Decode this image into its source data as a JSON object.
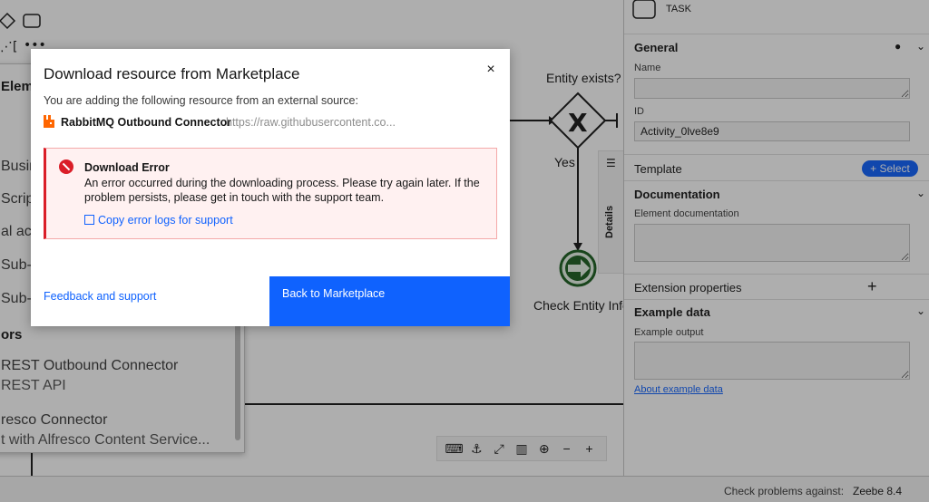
{
  "canvas": {
    "gateway_label": "Entity exists?",
    "yes_label": "Yes",
    "task_label": "Check Entity Info"
  },
  "element_popup": {
    "heading": "Elem",
    "items": [
      "Business",
      "Script task",
      "al activity",
      "Sub-process",
      "Sub-process"
    ],
    "group": "ors",
    "connectors": [
      {
        "name": "REST Outbound Connector",
        "desc": "REST API"
      },
      {
        "name": "resco Connector",
        "desc": "t with Alfresco Content Service..."
      }
    ]
  },
  "details_tab": {
    "label": "Details"
  },
  "properties": {
    "element_type": "TASK",
    "general": {
      "header": "General",
      "name_label": "Name",
      "name_value": "",
      "id_label": "ID",
      "id_value": "Activity_0lve8e9"
    },
    "template": {
      "header": "Template",
      "select_label": "+ Select"
    },
    "documentation": {
      "header": "Documentation",
      "element_doc_label": "Element documentation"
    },
    "extension": {
      "header": "Extension properties",
      "add_label": "+"
    },
    "example_data": {
      "header": "Example data",
      "output_label": "Example output",
      "about_link": "About example data"
    }
  },
  "status_bar": {
    "label": "Check problems against:",
    "engine": "Zeebe 8.4"
  },
  "modal": {
    "title": "Download resource from Marketplace",
    "close_label": "×",
    "intro": "You are adding the following resource from an external source:",
    "resource_name": "RabbitMQ Outbound Connector",
    "resource_url": "https://raw.githubusercontent.co...",
    "error_title": "Download Error",
    "error_message": "An error occurred during the downloading process. Please try again later. If the problem persists, please get in touch with the support team.",
    "copy_logs": "Copy error logs for support",
    "feedback": "Feedback and support",
    "back_button": "Back to Marketplace"
  },
  "colors": {
    "primary": "#0f62fe",
    "error": "#da1e28",
    "rabbitmq": "#ff6600",
    "task_green": "#1b5e20"
  }
}
